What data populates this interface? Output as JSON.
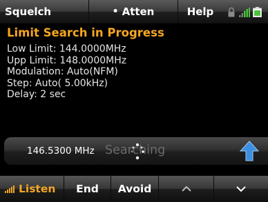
{
  "topbar": {
    "squelch": "Squelch",
    "atten": "Atten",
    "help": "Help",
    "icons": [
      "lock-icon",
      "signal-strength-icon",
      "battery-icon"
    ]
  },
  "heading": "Limit Search in Progress",
  "info": [
    "Low Limit: 144.0000MHz",
    "Upp Limit: 148.0000MHz",
    "Modulation: Auto(NFM)",
    "Step: Auto( 5.00kHz)",
    "Delay: 2 sec"
  ],
  "status": {
    "frequency": "146.5300 MHz",
    "state": "Searching"
  },
  "bottombar": {
    "listen": "Listen",
    "end": "End",
    "avoid": "Avoid",
    "up_icon": "chevron-up-icon",
    "down_icon": "chevron-down-icon"
  },
  "colors": {
    "accent": "#f5a623",
    "text": "#e6e6e6",
    "arrow": "#3d8fe0"
  }
}
